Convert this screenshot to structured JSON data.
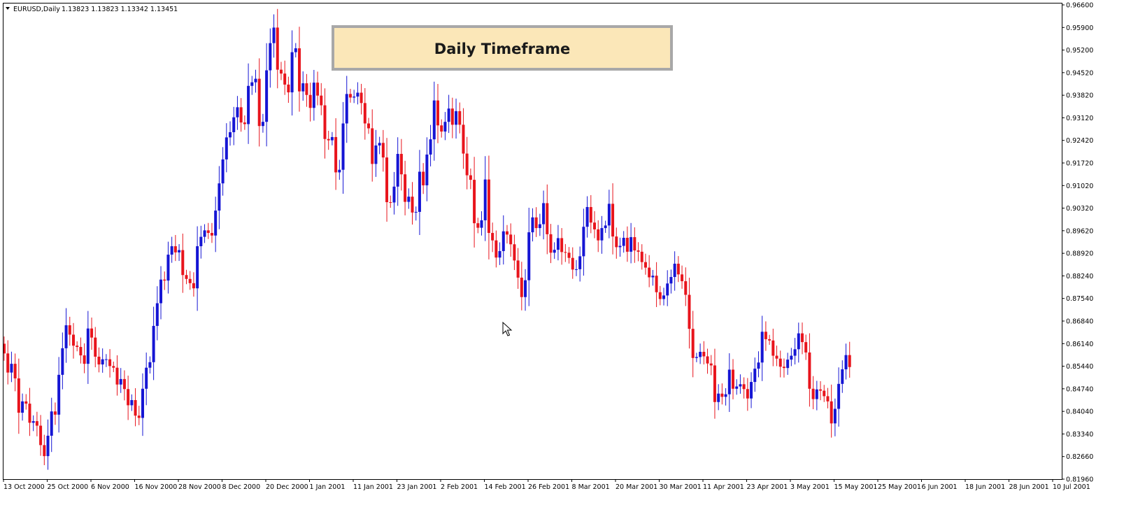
{
  "header": {
    "symbol": "EURUSD,Daily",
    "ohlc": "1.13823 1.13823 1.13342 1.13451",
    "dropdown_icon": "triangle-down-icon"
  },
  "banner": {
    "text": "Daily Timeframe",
    "fill_color": "#fbe7b8",
    "border_color": "#a8a8a8"
  },
  "colors": {
    "bull": "#1515d4",
    "bear": "#e8141c",
    "background": "#ffffff",
    "frame": "#000000"
  },
  "cursor_icon": "mouse-pointer-icon",
  "chart_data": {
    "type": "candlestick",
    "ylim": [
      0.8196,
      0.966
    ],
    "y_ticks": [
      "0.96600",
      "0.95900",
      "0.95200",
      "0.94520",
      "0.93820",
      "0.93120",
      "0.92420",
      "0.91720",
      "0.91020",
      "0.90320",
      "0.89620",
      "0.88920",
      "0.88240",
      "0.87540",
      "0.86840",
      "0.86140",
      "0.85440",
      "0.84740",
      "0.84040",
      "0.83340",
      "0.82660",
      "0.81960"
    ],
    "x_ticks": [
      "13 Oct 2000",
      "25 Oct 2000",
      "6 Nov 2000",
      "16 Nov 2000",
      "28 Nov 2000",
      "8 Dec 2000",
      "20 Dec 2000",
      "1 Jan 2001",
      "11 Jan 2001",
      "23 Jan 2001",
      "2 Feb 2001",
      "14 Feb 2001",
      "26 Feb 2001",
      "8 Mar 2001",
      "20 Mar 2001",
      "30 Mar 2001",
      "11 Apr 2001",
      "23 Apr 2001",
      "3 May 2001",
      "15 May 2001",
      "25 May 2001",
      "6 Jun 2001",
      "18 Jun 2001",
      "28 Jun 2001",
      "10 Jul 2001"
    ],
    "grid": false,
    "closes": [
      0.8584,
      0.8525,
      0.8552,
      0.8507,
      0.8401,
      0.8436,
      0.8429,
      0.837,
      0.8375,
      0.8361,
      0.8301,
      0.8267,
      0.833,
      0.8405,
      0.8395,
      0.8518,
      0.86,
      0.8671,
      0.8642,
      0.8608,
      0.8604,
      0.8578,
      0.8552,
      0.8661,
      0.8633,
      0.8574,
      0.855,
      0.8566,
      0.8566,
      0.8545,
      0.854,
      0.8488,
      0.8505,
      0.8474,
      0.8424,
      0.844,
      0.8392,
      0.8385,
      0.8475,
      0.854,
      0.8557,
      0.8669,
      0.8739,
      0.8812,
      0.8809,
      0.8889,
      0.8915,
      0.8896,
      0.8903,
      0.8826,
      0.8814,
      0.8801,
      0.8785,
      0.8915,
      0.8944,
      0.8964,
      0.8956,
      0.8948,
      0.9025,
      0.9109,
      0.9183,
      0.9251,
      0.9267,
      0.9313,
      0.9344,
      0.9297,
      0.9292,
      0.941,
      0.9421,
      0.9432,
      0.9286,
      0.9299,
      0.9458,
      0.9542,
      0.959,
      0.946,
      0.9448,
      0.9414,
      0.939,
      0.9514,
      0.9526,
      0.9393,
      0.9418,
      0.9382,
      0.9342,
      0.942,
      0.938,
      0.935,
      0.9246,
      0.9242,
      0.9252,
      0.9143,
      0.9151,
      0.9294,
      0.9385,
      0.9374,
      0.9377,
      0.9389,
      0.9357,
      0.9294,
      0.9279,
      0.9169,
      0.9226,
      0.9234,
      0.9189,
      0.9051,
      0.905,
      0.9099,
      0.92,
      0.9137,
      0.9052,
      0.9068,
      0.9019,
      0.9021,
      0.9145,
      0.9103,
      0.9198,
      0.9245,
      0.9365,
      0.9288,
      0.9269,
      0.9299,
      0.934,
      0.929,
      0.9332,
      0.929,
      0.9201,
      0.9134,
      0.912,
      0.8986,
      0.8972,
      0.8995,
      0.9121,
      0.8956,
      0.8933,
      0.888,
      0.89,
      0.8961,
      0.8951,
      0.8921,
      0.8871,
      0.8818,
      0.8758,
      0.881,
      0.8958,
      0.9004,
      0.8971,
      0.8983,
      0.9048,
      0.8952,
      0.8895,
      0.8904,
      0.894,
      0.8897,
      0.8895,
      0.8879,
      0.8843,
      0.8844,
      0.8884,
      0.8975,
      0.9036,
      0.8988,
      0.8967,
      0.8933,
      0.8971,
      0.8979,
      0.9046,
      0.8945,
      0.8912,
      0.8916,
      0.8941,
      0.8898,
      0.8943,
      0.8902,
      0.8898,
      0.8866,
      0.8849,
      0.8819,
      0.8824,
      0.8773,
      0.8752,
      0.8763,
      0.88,
      0.882,
      0.8861,
      0.8828,
      0.8807,
      0.8765,
      0.866,
      0.857,
      0.8573,
      0.8589,
      0.8575,
      0.8553,
      0.8547,
      0.8434,
      0.846,
      0.845,
      0.8458,
      0.8534,
      0.8475,
      0.8482,
      0.8489,
      0.8474,
      0.8445,
      0.8496,
      0.8537,
      0.8556,
      0.8651,
      0.8628,
      0.8624,
      0.8577,
      0.8568,
      0.8543,
      0.8539,
      0.8565,
      0.8577,
      0.8597,
      0.8646,
      0.8619,
      0.8587,
      0.8475,
      0.8443,
      0.8473,
      0.8469,
      0.8452,
      0.8436,
      0.8368,
      0.8413,
      0.849,
      0.8535,
      0.8579,
      0.8542
    ]
  }
}
